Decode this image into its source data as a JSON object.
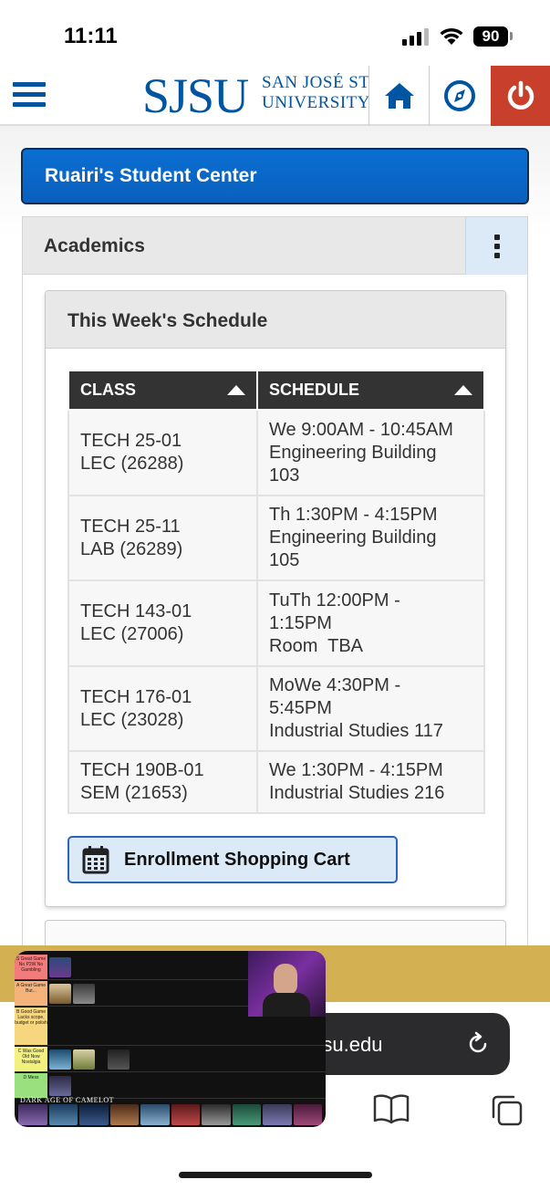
{
  "status_bar": {
    "time": "11:11",
    "battery": "90"
  },
  "header": {
    "logo_main": "SJSU",
    "logo_sub_line1": "SAN JOSÉ STATE",
    "logo_sub_line2": "UNIVERSITY",
    "brand_color": "#0055a2",
    "power_color": "#c8402c"
  },
  "banner": {
    "title": "Ruairi's Student Center"
  },
  "academics": {
    "title": "Academics",
    "schedule": {
      "title": "This Week's Schedule",
      "columns": [
        "CLASS",
        "SCHEDULE"
      ],
      "rows": [
        {
          "class_line1": "TECH 25-01",
          "class_line2": "LEC (26288)",
          "sched_line1": "We 9:00AM - 10:45AM",
          "sched_line2": "Engineering Building",
          "sched_line3": "103"
        },
        {
          "class_line1": "TECH 25-11",
          "class_line2": "LAB (26289)",
          "sched_line1": "Th 1:30PM - 4:15PM",
          "sched_line2": "Engineering Building",
          "sched_line3": "105"
        },
        {
          "class_line1": "TECH 143-01",
          "class_line2": "LEC (27006)",
          "sched_line1": "TuTh 12:00PM -",
          "sched_line2": "1:15PM",
          "sched_line3": "Room  TBA"
        },
        {
          "class_line1": "TECH 176-01",
          "class_line2": "LEC (23028)",
          "sched_line1": "MoWe 4:30PM -",
          "sched_line2": "5:45PM",
          "sched_line3": "Industrial Studies 117"
        },
        {
          "class_line1": "TECH 190B-01",
          "class_line2": "SEM (21653)",
          "sched_line1": "We 1:30PM - 4:15PM",
          "sched_line2": "Industrial Studies 216",
          "sched_line3": ""
        }
      ],
      "cart_button": "Enrollment Shopping Cart"
    }
  },
  "browser": {
    "url": "sjsu.edu"
  },
  "pip": {
    "game_title": "DARK AGE OF CAMELOT",
    "tiers": [
      {
        "label": "S Great Game No P2W No Gambling",
        "color": "#f37b7b"
      },
      {
        "label": "A Great Game But...",
        "color": "#f5b37a"
      },
      {
        "label": "B Good Game Lacks scope, budget or polish",
        "color": "#f6d67e"
      },
      {
        "label": "C Was Good Old Now Nostalgia",
        "color": "#f3f07e"
      },
      {
        "label": "D Mess",
        "color": "#9be07e"
      }
    ]
  }
}
